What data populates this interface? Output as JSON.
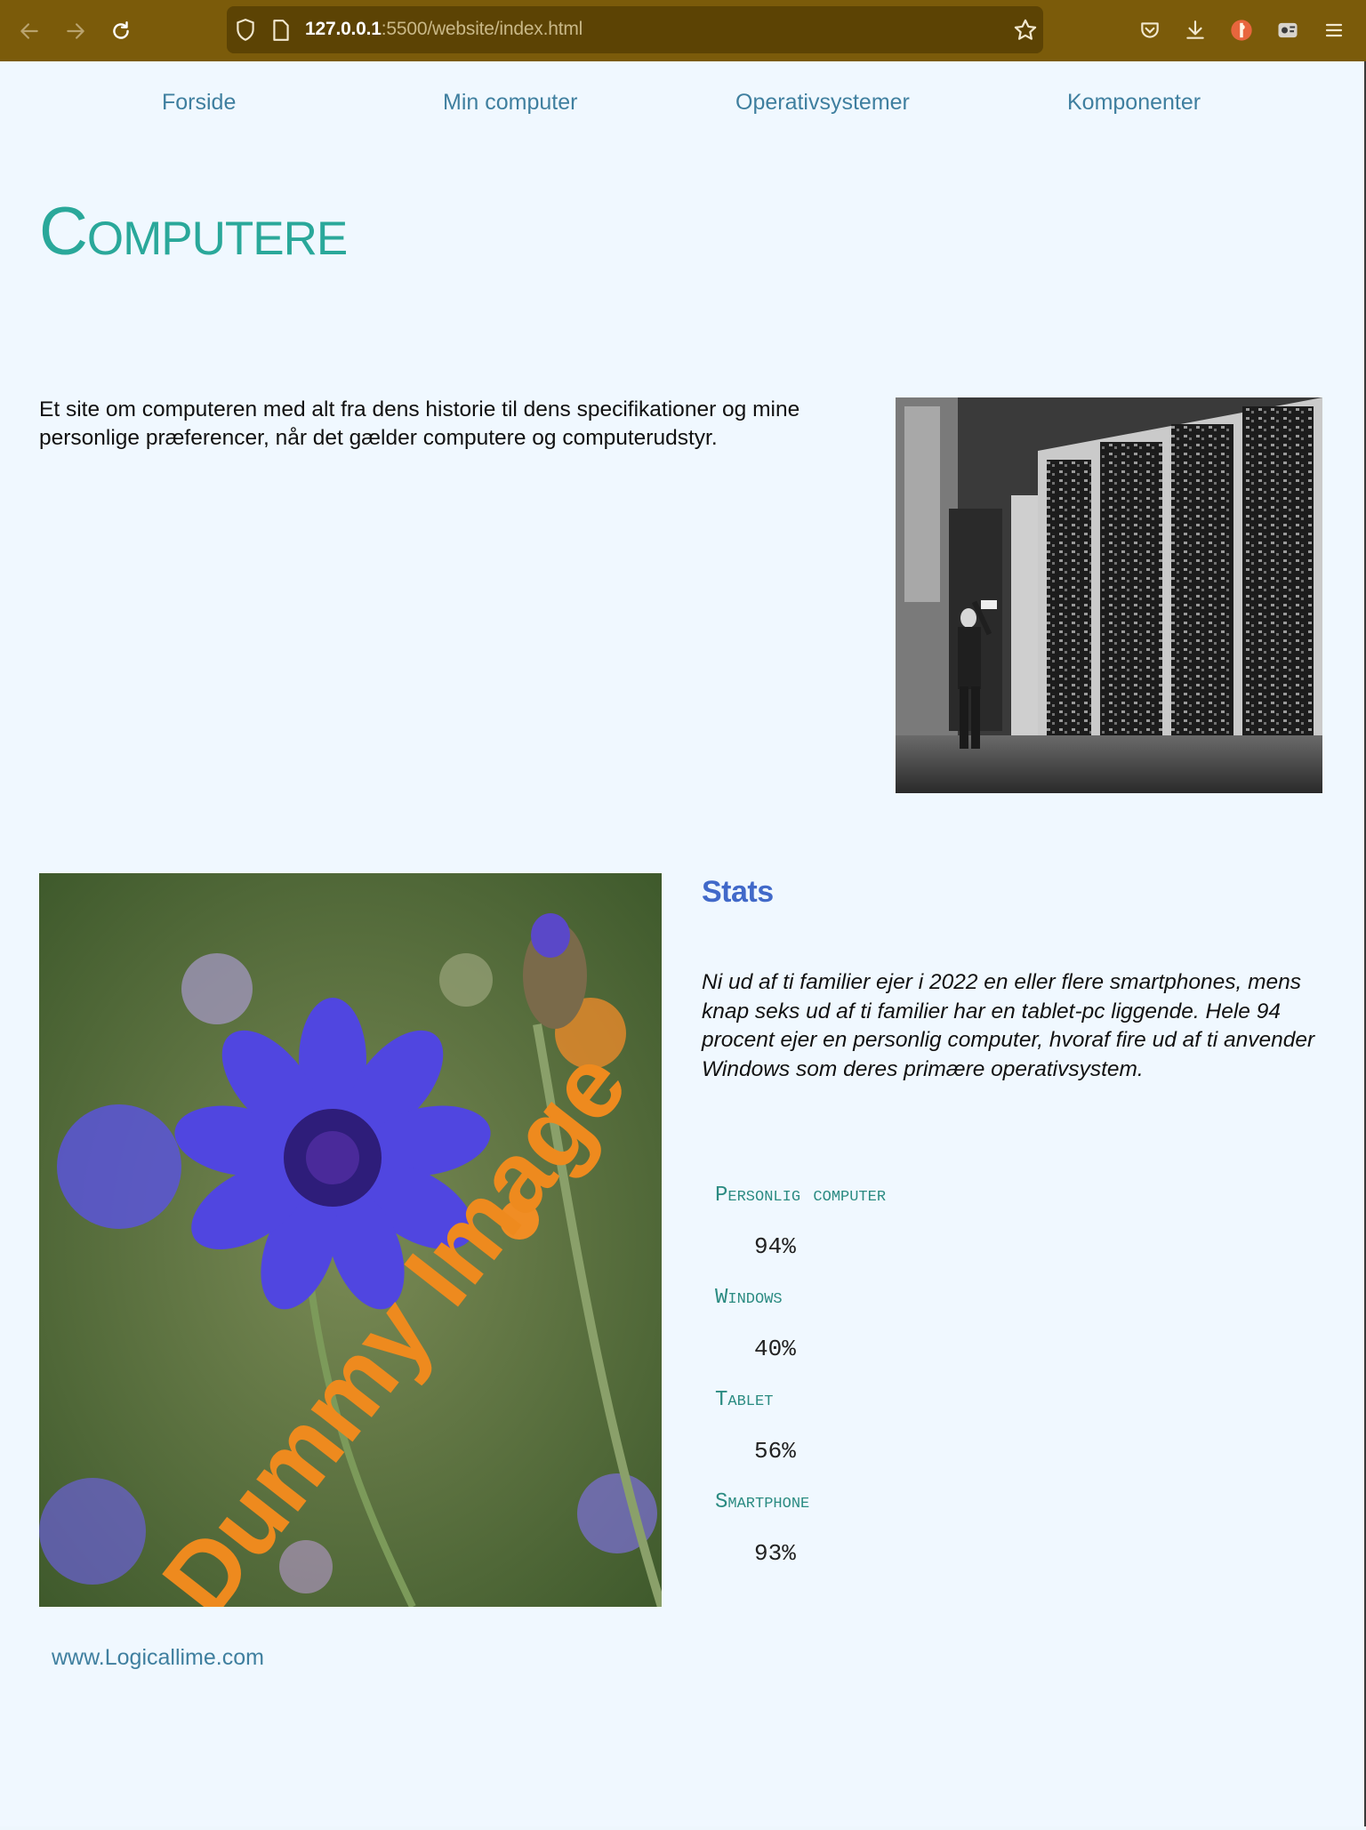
{
  "browser": {
    "url_host": "127.0.0.1",
    "url_rest": ":5500/website/index.html",
    "chrome_color": "#7b5b0a",
    "icons": [
      "back-icon",
      "forward-icon",
      "reload-icon",
      "shield-icon",
      "page-icon",
      "star-icon",
      "pocket-icon",
      "download-icon",
      "extension-icon",
      "extension-puzzle-icon",
      "menu-icon"
    ]
  },
  "nav": {
    "items": [
      "Forside",
      "Min computer",
      "Operativsystemer",
      "Komponenter"
    ]
  },
  "header": {
    "title": "Computere"
  },
  "intro": {
    "text": "Et site om computeren med alt fra dens historie til dens specifikationer og mine personlige præferencer, når det gælder computere og computerudstyr."
  },
  "images": {
    "dummy_label": "Dummy Image"
  },
  "stats": {
    "heading": "Stats",
    "paragraph": "Ni ud af ti familier ejer i 2022 en eller flere smartphones, mens knap seks ud af ti familier har en tablet-pc liggende. Hele 94 procent ejer en personlig computer, hvoraf fire ud af ti anvender Windows som deres primære operativsystem.",
    "items": [
      {
        "label": "Personlig computer",
        "value": "94%"
      },
      {
        "label": "Windows",
        "value": "40%"
      },
      {
        "label": "Tablet",
        "value": "56%"
      },
      {
        "label": "Smartphone",
        "value": "93%"
      }
    ]
  },
  "footer": {
    "link": "www.Logicallime.com"
  },
  "colors": {
    "page_bg": "#f0f8ff",
    "title": "#2aa89a",
    "nav": "#3f7f9f",
    "stats_heading": "#4169c9",
    "stat_label": "#2b8b82"
  }
}
